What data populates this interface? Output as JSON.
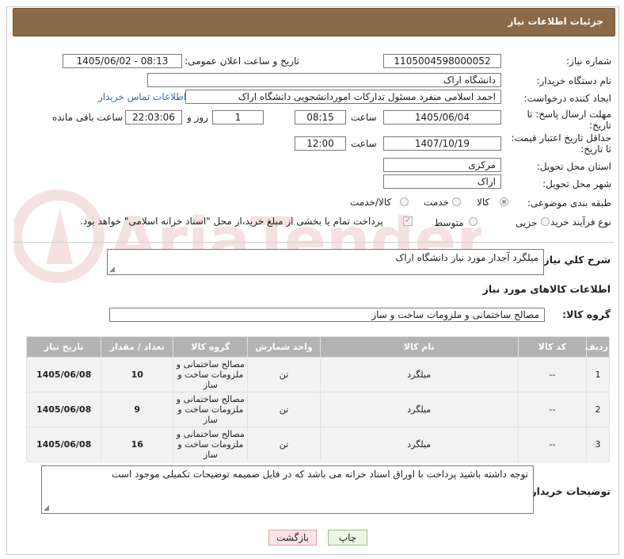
{
  "header": {
    "title": "جزئیات اطلاعات نیاز"
  },
  "form": {
    "need_number_label": "شماره نیاز:",
    "need_number": "1105004598000052",
    "announce_label": "تاریخ و ساعت اعلان عمومی:",
    "announce_value": "1405/06/02 - 08:13",
    "buyer_org_label": "نام دستگاه خریدار:",
    "buyer_org": "دانشگاه اراک",
    "creator_label": "ایجاد کننده درخواست:",
    "creator": "احمد  اسلامی منفرد مسئول تدارکات اموردانشجویی دانشگاه اراک",
    "contact_link": "اطلاعات تماس خریدار",
    "deadline_label_1": "مهلت ارسال پاسخ: تا",
    "deadline_label_2": "تاریخ:",
    "deadline_date": "1405/06/04",
    "time_label": "ساعت",
    "deadline_time": "08:15",
    "days_value": "1",
    "days_label": "روز و",
    "remaining_time": "22:03:06",
    "remaining_label": "ساعت باقی مانده",
    "price_validity_label_1": "حداقل تاریخ اعتبار قیمت:",
    "price_validity_label_2": "تا تاریخ:",
    "price_validity_date": "1407/10/19",
    "price_validity_time": "12:00",
    "province_label": "استان محل تحویل:",
    "province": "مرکزی",
    "city_label": "شهر محل تحویل:",
    "city": "اراک",
    "category_label": "طبقه بندی موضوعی:",
    "category_options": [
      "کالا",
      "خدمت",
      "کالا/خدمت"
    ],
    "category_selected": "کالا",
    "process_label": "نوع فرآیند خرید :",
    "process_options": [
      "جزیی",
      "متوسط"
    ],
    "payment_note": "پرداخت تمام یا بخشی از مبلغ خرید،از محل \"اسناد خزانه اسلامی\" خواهد بود."
  },
  "summary": {
    "label": "شرح کلي نياز:",
    "value": "میلگرد آجدار مورد نیاز دانشگاه اراک"
  },
  "goods": {
    "section_title": "اطلاعات کالاهای مورد نیاز",
    "group_label": "گروه کالا:",
    "group_value": "مصالح ساختمانی و ملزومات ساخت و ساز",
    "columns": [
      "ردیف",
      "کد کالا",
      "نام کالا",
      "واحد شمارش",
      "گروه کالا",
      "تعداد / مقدار",
      "تاریخ نیاز"
    ],
    "rows": [
      {
        "row": "1",
        "code": "--",
        "name": "میلگرد",
        "unit": "تن",
        "group": "مصالح ساختمانی و ملزومات ساخت و ساز",
        "qty": "10",
        "date": "1405/06/08"
      },
      {
        "row": "2",
        "code": "--",
        "name": "میلگرد",
        "unit": "تن",
        "group": "مصالح ساختمانی و ملزومات ساخت و ساز",
        "qty": "9",
        "date": "1405/06/08"
      },
      {
        "row": "3",
        "code": "--",
        "name": "میلگرد",
        "unit": "تن",
        "group": "مصالح ساختمانی و ملزومات ساخت و ساز",
        "qty": "16",
        "date": "1405/06/08"
      }
    ]
  },
  "buyer_notes": {
    "label": "توضیحات خریدار:",
    "value": "توجه داشته باشید پرداخت با اوراق اسناد خزانه می باشد که در فایل ضمیمه توضیحات تکمیلی موجود است"
  },
  "buttons": {
    "print": "چاپ",
    "back": "بازگشت"
  },
  "watermark": {
    "text": "AriaTender.net"
  },
  "colors": {
    "header_bg": "#8b6a47",
    "table_header_bg": "#b3b3b3",
    "back_button_bg": "#fde3e3",
    "print_button_bg": "#e9f7e4",
    "link": "#2b6fb6"
  }
}
